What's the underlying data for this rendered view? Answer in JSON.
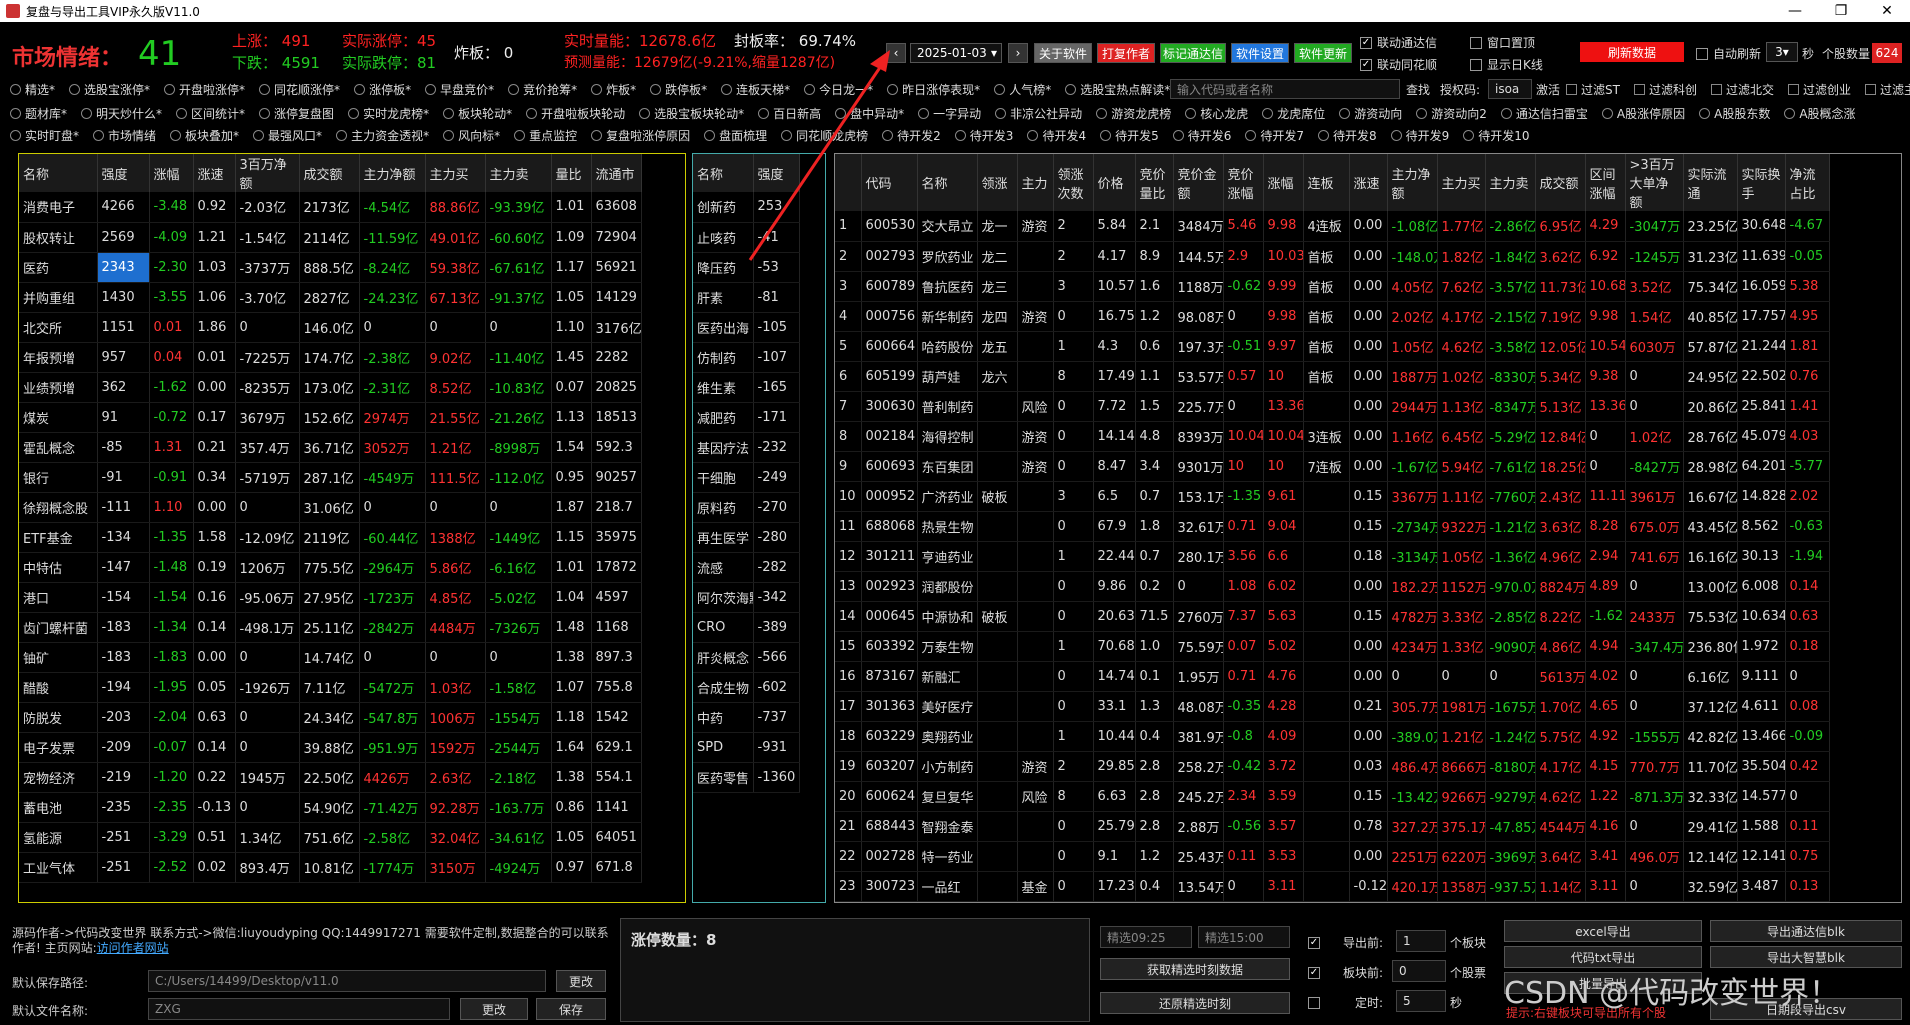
{
  "window": {
    "title": "复盘与导出工具VIP永久版V11.0"
  },
  "sentiment": {
    "label": "市场情绪：",
    "value": "41"
  },
  "stats": {
    "up_label": "上涨：",
    "up_value": "491",
    "down_label": "下跌：",
    "down_value": "4591",
    "real_up_label": "实际涨停：",
    "real_up_value": "45",
    "real_down_label": "实际跌停：",
    "real_down_value": "81",
    "broken_label": "炸板：",
    "broken_value": "0",
    "volume_label": "实时量能：",
    "volume_value": "12678.6亿",
    "seal_label": "封板率：",
    "seal_value": "69.74%",
    "forecast_label": "预测量能：",
    "forecast_value": "12679亿(-9.21%,缩量1287亿)"
  },
  "toolbar": {
    "date": "2025-01-03",
    "about": "关于软件",
    "tag": "打复作者",
    "link": "标记通达信",
    "settings": "软件设置",
    "update": "软件更新",
    "link_tdx": "联动通达信",
    "link_ths": "联动同花顺",
    "pin_window": "窗口置顶",
    "show_kline": "显示日K线",
    "refresh": "刷新数据",
    "auto_refresh": "自动刷新",
    "interval": "3",
    "unit": "秒",
    "count_label": "个股数量",
    "count": "624"
  },
  "options": {
    "row1": [
      "精选*",
      "选股宝涨停*",
      "开盘啦涨停*",
      "同花顺涨停*",
      "涨停板*",
      "早盘竞价*",
      "竞价抢筹*",
      "炸板*",
      "跌停板*",
      "连板天梯*",
      "今日龙一*",
      "昨日涨停表现*",
      "人气榜*",
      "选股宝热点解读*"
    ],
    "row2": [
      "题材库*",
      "明天炒什么*",
      "区间统计*",
      "涨停复盘图",
      "实时龙虎榜*",
      "板块轮动*",
      "开盘啦板块轮动",
      "选股宝板块轮动*",
      "百日新高",
      "盘中异动*",
      "一字异动",
      "非凉公社异动",
      "游资龙虎榜",
      "核心龙虎",
      "龙虎席位",
      "游资动向",
      "游资动向2",
      "通达信扫雷宝",
      "A股涨停原因",
      "A股股东数",
      "A股概念涨"
    ],
    "row3": [
      "实时盯盘*",
      "市场情绪",
      "板块叠加*",
      "最强风口*",
      "主力资金透视*",
      "风向标*",
      "重点监控",
      "复盘啦涨停原因",
      "盘面梳理",
      "同花顺龙虎榜",
      "待开发2",
      "待开发3",
      "待开发4",
      "待开发5",
      "待开发6",
      "待开发7",
      "待开发8",
      "待开发9",
      "待开发10"
    ],
    "search_placeholder": "输入代码或者名称",
    "search": "查找",
    "auth_label": "授权码:",
    "auth": "isoa",
    "jump": "激活",
    "filters": [
      "过滤ST",
      "过滤科创",
      "过滤北交",
      "过滤创业",
      "过滤主板"
    ]
  },
  "left_table": {
    "headers": [
      "名称",
      "强度",
      "涨幅",
      "涨速",
      "3百万净额",
      "成交额",
      "主力净额",
      "主力买",
      "主力卖",
      "量比",
      "流通市"
    ],
    "rows": [
      [
        "消费电子",
        "4266",
        "-3.48",
        "0.92",
        "-2.03亿",
        "2173亿",
        "-4.54亿",
        "88.86亿",
        "-93.39亿",
        "1.01",
        "63608"
      ],
      [
        "股权转让",
        "2569",
        "-4.09",
        "1.21",
        "-1.54亿",
        "2114亿",
        "-11.59亿",
        "49.01亿",
        "-60.60亿",
        "1.09",
        "72904"
      ],
      [
        "医药",
        "2343",
        "-2.30",
        "1.03",
        "-3737万",
        "888.5亿",
        "-8.24亿",
        "59.38亿",
        "-67.61亿",
        "1.17",
        "56921"
      ],
      [
        "并购重组",
        "1430",
        "-3.55",
        "1.06",
        "-3.70亿",
        "2827亿",
        "-24.23亿",
        "67.13亿",
        "-91.37亿",
        "1.05",
        "14129"
      ],
      [
        "北交所",
        "1151",
        "0.01",
        "1.86",
        "0",
        "146.0亿",
        "0",
        "0",
        "0",
        "1.10",
        "3176亿"
      ],
      [
        "年报预增",
        "957",
        "0.04",
        "0.01",
        "-7225万",
        "174.7亿",
        "-2.38亿",
        "9.02亿",
        "-11.40亿",
        "1.45",
        "2282"
      ],
      [
        "业绩预增",
        "362",
        "-1.62",
        "0.00",
        "-8235万",
        "173.0亿",
        "-2.31亿",
        "8.52亿",
        "-10.83亿",
        "0.07",
        "20825"
      ],
      [
        "煤炭",
        "91",
        "-0.72",
        "0.17",
        "3679万",
        "152.6亿",
        "2974万",
        "21.55亿",
        "-21.26亿",
        "1.13",
        "18513"
      ],
      [
        "霍乱概念",
        "-85",
        "1.31",
        "0.21",
        "357.4万",
        "36.71亿",
        "3052万",
        "1.21亿",
        "-8998万",
        "1.54",
        "592.3"
      ],
      [
        "银行",
        "-91",
        "-0.91",
        "0.34",
        "-5719万",
        "287.1亿",
        "-4549万",
        "111.5亿",
        "-112.0亿",
        "0.95",
        "90257"
      ],
      [
        "徐翔概念股",
        "-111",
        "1.10",
        "0.00",
        "0",
        "31.06亿",
        "0",
        "0",
        "0",
        "1.87",
        "218.7"
      ],
      [
        "ETF基金",
        "-134",
        "-1.35",
        "1.58",
        "-12.09亿",
        "2119亿",
        "-60.44亿",
        "1388亿",
        "-1449亿",
        "1.15",
        "35975"
      ],
      [
        "中特估",
        "-147",
        "-1.48",
        "0.19",
        "1206万",
        "775.5亿",
        "-2964万",
        "5.86亿",
        "-6.16亿",
        "1.01",
        "17872"
      ],
      [
        "港口",
        "-154",
        "-1.54",
        "0.16",
        "-95.06万",
        "27.95亿",
        "-1723万",
        "4.85亿",
        "-5.02亿",
        "1.04",
        "4597"
      ],
      [
        "齿门螺杆菌",
        "-183",
        "-1.34",
        "0.14",
        "-498.1万",
        "25.11亿",
        "-2842万",
        "4484万",
        "-7326万",
        "1.48",
        "1168"
      ],
      [
        "铀矿",
        "-183",
        "-1.83",
        "0.00",
        "0",
        "14.74亿",
        "0",
        "0",
        "0",
        "1.38",
        "897.3"
      ],
      [
        "醋酸",
        "-194",
        "-1.95",
        "0.05",
        "-1926万",
        "7.11亿",
        "-5472万",
        "1.03亿",
        "-1.58亿",
        "1.07",
        "755.8"
      ],
      [
        "防脱发",
        "-203",
        "-2.04",
        "0.63",
        "0",
        "24.34亿",
        "-547.8万",
        "1006万",
        "-1554万",
        "1.18",
        "1542"
      ],
      [
        "电子发票",
        "-209",
        "-0.07",
        "0.14",
        "0",
        "39.88亿",
        "-951.9万",
        "1592万",
        "-2544万",
        "1.64",
        "629.1"
      ],
      [
        "宠物经济",
        "-219",
        "-1.20",
        "0.22",
        "1945万",
        "22.50亿",
        "4426万",
        "2.63亿",
        "-2.18亿",
        "1.38",
        "554.1"
      ],
      [
        "蓄电池",
        "-235",
        "-2.35",
        "-0.13",
        "0",
        "54.90亿",
        "-71.42万",
        "92.28万",
        "-163.7万",
        "0.86",
        "1141"
      ],
      [
        "氢能源",
        "-251",
        "-3.29",
        "0.51",
        "1.34亿",
        "751.6亿",
        "-2.58亿",
        "32.04亿",
        "-34.61亿",
        "1.05",
        "64051"
      ],
      [
        "工业气体",
        "-251",
        "-2.52",
        "0.02",
        "893.4万",
        "10.81亿",
        "-1774万",
        "3150万",
        "-4924万",
        "0.97",
        "671.8"
      ]
    ]
  },
  "mid_table": {
    "headers": [
      "名称",
      "强度"
    ],
    "rows": [
      [
        "创新药",
        "253"
      ],
      [
        "止咳药",
        "-41"
      ],
      [
        "降压药",
        "-53"
      ],
      [
        "肝素",
        "-81"
      ],
      [
        "医药出海",
        "-105"
      ],
      [
        "仿制药",
        "-107"
      ],
      [
        "维生素",
        "-165"
      ],
      [
        "减肥药",
        "-171"
      ],
      [
        "基因疗法",
        "-232"
      ],
      [
        "干细胞",
        "-249"
      ],
      [
        "原料药",
        "-270"
      ],
      [
        "再生医学",
        "-280"
      ],
      [
        "流感",
        "-282"
      ],
      [
        "阿尔茨海默",
        "-342"
      ],
      [
        "CRO",
        "-389"
      ],
      [
        "肝炎概念",
        "-566"
      ],
      [
        "合成生物",
        "-602"
      ],
      [
        "中药",
        "-737"
      ],
      [
        "SPD",
        "-931"
      ],
      [
        "医药零售",
        "-1360"
      ]
    ]
  },
  "right_table": {
    "headers": [
      "",
      "代码",
      "名称",
      "领涨",
      "主力",
      "领涨次数",
      "价格",
      "竞价量比",
      "竞价金额",
      "竞价涨幅",
      "涨幅",
      "连板",
      "涨速",
      "主力净额",
      "主力买",
      "主力卖",
      "成交额",
      "区间涨幅",
      ">3百万大单净额",
      "实际流通",
      "实际换手",
      "净流占比"
    ],
    "rows": [
      [
        "1",
        "600530",
        "交大昂立",
        "龙一",
        "游资",
        "2",
        "5.84",
        "2.1",
        "3484万",
        "5.46",
        "9.98",
        "4连板",
        "0.00",
        "-1.08亿",
        "1.77亿",
        "-2.86亿",
        "6.95亿",
        "4.29",
        "-3047万",
        "23.25亿",
        "30.648",
        "-4.67"
      ],
      [
        "2",
        "002793",
        "罗欣药业",
        "龙二",
        "",
        "2",
        "4.17",
        "8.9",
        "144.5万",
        "2.9",
        "10.03",
        "首板",
        "0.00",
        "-148.0万",
        "1.82亿",
        "-1.84亿",
        "3.62亿",
        "6.92",
        "-1245万",
        "31.23亿",
        "11.639",
        "-0.05"
      ],
      [
        "3",
        "600789",
        "鲁抗医药",
        "龙三",
        "",
        "3",
        "10.57",
        "1.6",
        "1188万",
        "-0.62",
        "9.99",
        "首板",
        "0.00",
        "4.05亿",
        "7.62亿",
        "-3.57亿",
        "11.73亿",
        "10.68",
        "3.52亿",
        "75.34亿",
        "16.059",
        "5.38"
      ],
      [
        "4",
        "000756",
        "新华制药",
        "龙四",
        "游资",
        "0",
        "16.75",
        "1.2",
        "98.08万",
        "0",
        "9.98",
        "首板",
        "0.00",
        "2.02亿",
        "4.17亿",
        "-2.15亿",
        "7.19亿",
        "9.98",
        "1.54亿",
        "40.85亿",
        "17.757",
        "4.95"
      ],
      [
        "5",
        "600664",
        "哈药股份",
        "龙五",
        "",
        "1",
        "4.3",
        "0.6",
        "197.3万",
        "-0.51",
        "9.97",
        "首板",
        "0.00",
        "1.05亿",
        "4.62亿",
        "-3.58亿",
        "12.05亿",
        "10.54",
        "6030万",
        "57.87亿",
        "21.244",
        "1.81"
      ],
      [
        "6",
        "605199",
        "葫芦娃",
        "龙六",
        "",
        "8",
        "17.49",
        "1.1",
        "53.57万",
        "0.57",
        "10",
        "首板",
        "0.00",
        "1887万",
        "1.02亿",
        "-8330万",
        "5.34亿",
        "9.38",
        "0",
        "24.95亿",
        "22.502",
        "0.76"
      ],
      [
        "7",
        "300630",
        "普利制药",
        "",
        "风险",
        "0",
        "7.72",
        "1.5",
        "225.7万",
        "0",
        "13.36",
        "",
        "0.00",
        "2944万",
        "1.13亿",
        "-8347万",
        "5.13亿",
        "13.36",
        "0",
        "20.86亿",
        "25.841",
        "1.41"
      ],
      [
        "8",
        "002184",
        "海得控制",
        "",
        "游资",
        "0",
        "14.14",
        "4.8",
        "8393万",
        "10.04",
        "10.04",
        "3连板",
        "0.00",
        "1.16亿",
        "6.45亿",
        "-5.29亿",
        "12.84亿",
        "0",
        "1.02亿",
        "28.76亿",
        "45.079",
        "4.03"
      ],
      [
        "9",
        "600693",
        "东百集团",
        "",
        "游资",
        "0",
        "8.47",
        "3.4",
        "9301万",
        "10",
        "10",
        "7连板",
        "0.00",
        "-1.67亿",
        "5.94亿",
        "-7.61亿",
        "18.25亿",
        "0",
        "-8427万",
        "28.98亿",
        "64.201",
        "-5.77"
      ],
      [
        "10",
        "000952",
        "广济药业",
        "破板",
        "",
        "3",
        "6.5",
        "0.7",
        "153.1万",
        "-1.35",
        "9.61",
        "",
        "0.15",
        "3367万",
        "1.11亿",
        "-7760万",
        "2.43亿",
        "11.11",
        "3961万",
        "16.67亿",
        "14.828",
        "2.02"
      ],
      [
        "11",
        "688068",
        "热景生物",
        "",
        "",
        "0",
        "67.9",
        "1.8",
        "32.61万",
        "0.71",
        "9.04",
        "",
        "0.15",
        "-2734万",
        "9322万",
        "-1.21亿",
        "3.63亿",
        "8.28",
        "675.0万",
        "43.45亿",
        "8.562",
        "-0.63"
      ],
      [
        "12",
        "301211",
        "亨迪药业",
        "",
        "",
        "1",
        "22.44",
        "0.7",
        "280.1万",
        "3.56",
        "6.6",
        "",
        "0.18",
        "-3134万",
        "1.05亿",
        "-1.36亿",
        "4.96亿",
        "2.94",
        "741.6万",
        "16.16亿",
        "30.13",
        "-1.94"
      ],
      [
        "13",
        "002923",
        "润都股份",
        "",
        "",
        "0",
        "9.86",
        "0.2",
        "0",
        "1.08",
        "6.02",
        "",
        "0.00",
        "182.2万",
        "1152万",
        "-970.0万",
        "8824万",
        "4.89",
        "0",
        "13.00亿",
        "6.008",
        "0.14"
      ],
      [
        "14",
        "000645",
        "中源协和",
        "破板",
        "",
        "0",
        "20.63",
        "71.5",
        "2760万",
        "7.37",
        "5.63",
        "",
        "0.15",
        "4782万",
        "3.33亿",
        "-2.85亿",
        "8.22亿",
        "-1.62",
        "2433万",
        "75.53亿",
        "10.634",
        "0.63"
      ],
      [
        "15",
        "603392",
        "万泰生物",
        "",
        "",
        "1",
        "70.68",
        "1.0",
        "75.59万",
        "0.07",
        "5.02",
        "",
        "0.00",
        "4234万",
        "1.33亿",
        "-9090万",
        "4.86亿",
        "4.94",
        "-347.4万",
        "236.80亿",
        "1.972",
        "0.18"
      ],
      [
        "16",
        "873167",
        "新融汇",
        "",
        "",
        "0",
        "14.74",
        "0.1",
        "1.95万",
        "0.71",
        "4.76",
        "",
        "0.00",
        "0",
        "0",
        "0",
        "5613万",
        "4.02",
        "0",
        "6.16亿",
        "9.111",
        "0"
      ],
      [
        "17",
        "301363",
        "美好医疗",
        "",
        "",
        "0",
        "33.1",
        "1.3",
        "48.08万",
        "-0.35",
        "4.28",
        "",
        "0.21",
        "305.7万",
        "1981万",
        "-1675万",
        "1.70亿",
        "4.65",
        "0",
        "37.12亿",
        "4.611",
        "0.08"
      ],
      [
        "18",
        "603229",
        "奥翔药业",
        "",
        "",
        "1",
        "10.44",
        "0.4",
        "381.9万",
        "-0.8",
        "4.09",
        "",
        "0.00",
        "-389.0万",
        "1.21亿",
        "-1.24亿",
        "5.75亿",
        "4.92",
        "-1555万",
        "42.82亿",
        "13.466",
        "-0.09"
      ],
      [
        "19",
        "603207",
        "小方制药",
        "",
        "游资",
        "2",
        "29.85",
        "2.8",
        "258.2万",
        "-0.42",
        "3.72",
        "",
        "0.03",
        "486.4万",
        "8666万",
        "-8180万",
        "4.17亿",
        "4.15",
        "770.7万",
        "11.70亿",
        "35.504",
        "0.42"
      ],
      [
        "20",
        "600624",
        "复旦复华",
        "",
        "风险",
        "8",
        "6.63",
        "2.8",
        "245.2万",
        "2.34",
        "3.59",
        "",
        "0.15",
        "-13.42万",
        "9266万",
        "-9279万",
        "4.62亿",
        "1.22",
        "-871.3万",
        "32.33亿",
        "14.577",
        "0"
      ],
      [
        "21",
        "688443",
        "智翔金泰",
        "",
        "",
        "0",
        "25.79",
        "2.8",
        "2.88万",
        "-0.56",
        "3.57",
        "",
        "0.78",
        "327.2万",
        "375.1万",
        "-47.85万",
        "4544万",
        "4.16",
        "0",
        "29.41亿",
        "1.588",
        "0.11"
      ],
      [
        "22",
        "002728",
        "特一药业",
        "",
        "",
        "0",
        "9.1",
        "1.2",
        "25.43万",
        "0.11",
        "3.53",
        "",
        "0.00",
        "2251万",
        "6220万",
        "-3969万",
        "3.64亿",
        "3.41",
        "496.0万",
        "12.14亿",
        "12.141",
        "0.75"
      ],
      [
        "23",
        "300723",
        "一品红",
        "",
        "基金",
        "0",
        "17.23",
        "0.4",
        "13.54万",
        "0",
        "3.11",
        "",
        "-0.12",
        "420.1万",
        "1358万",
        "-937.5万",
        "1.14亿",
        "3.11",
        "0",
        "32.59亿",
        "3.487",
        "0.13"
      ]
    ]
  },
  "bottom": {
    "author_note": "源码作者->代码改变世界 联系方式->微信:liuyoudyping QQ:1449917271 需要软件定制,数据整合的可以联系作者! 主页网站:",
    "site_link": "访问作者网站",
    "save_path_label": "默认保存路径:",
    "save_path": "C:/Users/14499/Desktop/v11.0",
    "change": "更改",
    "file_name_label": "默认文件名称:",
    "file_name": "ZXG",
    "change2": "更改",
    "save": "保存",
    "limit_up_label": "涨停数量：8",
    "filter0925": "精选09:25",
    "filter1500": "精选15:00",
    "get_snapshot": "获取精选时刻数据",
    "restore": "还原精选时刻",
    "export_prev_label": "导出前:",
    "export_prev": "1",
    "export_prev_unit": "个板块",
    "block_prev_label": "板块前:",
    "block_prev": "0",
    "block_prev_unit": "个股票",
    "timer_label": "定时:",
    "timer": "5",
    "timer_unit": "秒",
    "excel_export": "excel导出",
    "tdx_export": "导出通达信blk",
    "code_txt_export": "代码txt导出",
    "dzh_export": "导出大智慧blk",
    "batch_export": "批量导出",
    "csv_export": "日期段导出csv",
    "tip": "提示:右键板块可导出所有个股",
    "watermark": "CSDN @代码改变世界！"
  },
  "colors": {
    "up": "#ff3333",
    "down": "#22cc22",
    "accent": "#ffff00",
    "highlight": "#1e6fd0"
  }
}
